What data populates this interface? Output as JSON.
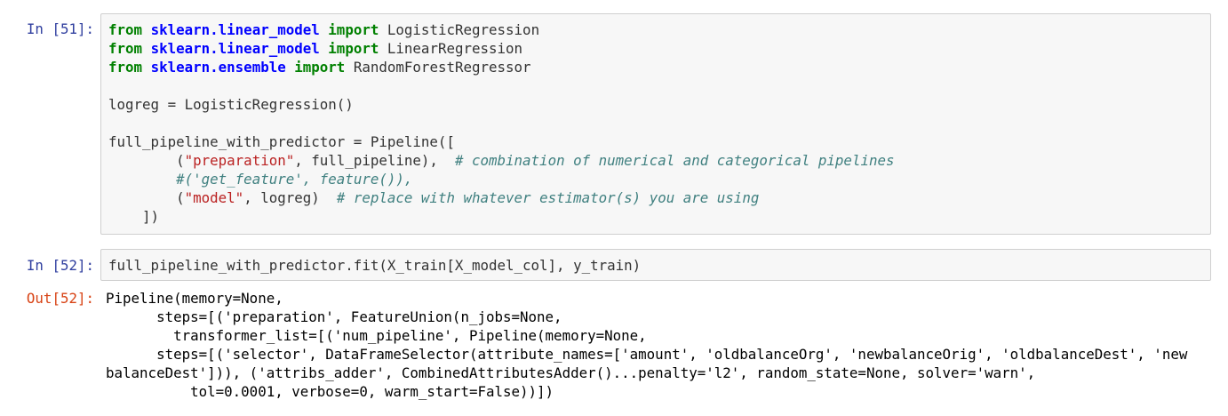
{
  "cells": [
    {
      "prompt": "In [51]:",
      "lines": {
        "l1": {
          "kw1": "from",
          "mod": "sklearn.linear_model",
          "kw2": "import",
          "name": "LogisticRegression"
        },
        "l2": {
          "kw1": "from",
          "mod": "sklearn.linear_model",
          "kw2": "import",
          "name": "LinearRegression"
        },
        "l3": {
          "kw1": "from",
          "mod": "sklearn.ensemble",
          "kw2": "import",
          "name": "RandomForestRegressor"
        },
        "l5": "logreg = LogisticRegression()",
        "l7": "full_pipeline_with_predictor = Pipeline([",
        "l8": {
          "pre": "        (",
          "str": "\"preparation\"",
          "post": ", full_pipeline),  ",
          "cmt": "# combination of numerical and categorical pipelines"
        },
        "l9": {
          "pre": "        ",
          "cmt": "#('get_feature', feature()),"
        },
        "l10": {
          "pre": "        (",
          "str": "\"model\"",
          "post": ", logreg)  ",
          "cmt": "# replace with whatever estimator(s) you are using"
        },
        "l11": "    ])"
      }
    },
    {
      "prompt": "In [52]:",
      "code": "full_pipeline_with_predictor.fit(X_train[X_model_col], y_train)"
    },
    {
      "prompt": "Out[52]:",
      "output": "Pipeline(memory=None,\n      steps=[('preparation', FeatureUnion(n_jobs=None,\n        transformer_list=[('num_pipeline', Pipeline(memory=None,\n      steps=[('selector', DataFrameSelector(attribute_names=['amount', 'oldbalanceOrg', 'newbalanceOrig', 'oldbalanceDest', 'new\nbalanceDest'])), ('attribs_adder', CombinedAttributesAdder()...penalty='l2', random_state=None, solver='warn',\n          tol=0.0001, verbose=0, warm_start=False))])"
    }
  ]
}
